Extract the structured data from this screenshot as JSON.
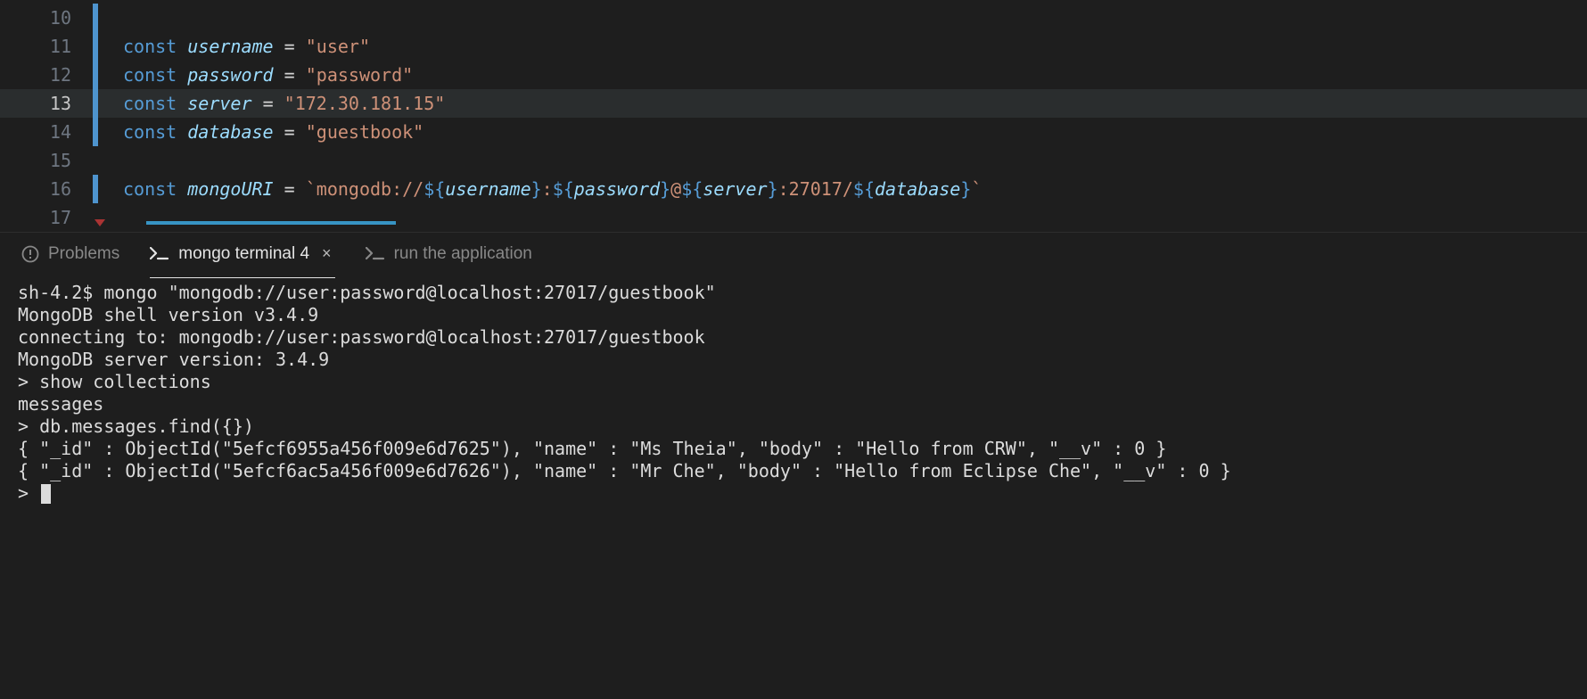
{
  "editor": {
    "lines": [
      {
        "num": "10",
        "git": true,
        "tokens": []
      },
      {
        "num": "11",
        "git": true,
        "tokens": [
          {
            "c": "tok-kw",
            "t": "const"
          },
          {
            "c": "",
            "t": " "
          },
          {
            "c": "tok-var",
            "t": "username"
          },
          {
            "c": "",
            "t": " "
          },
          {
            "c": "tok-op",
            "t": "="
          },
          {
            "c": "",
            "t": " "
          },
          {
            "c": "tok-str",
            "t": "\"user\""
          }
        ]
      },
      {
        "num": "12",
        "git": true,
        "tokens": [
          {
            "c": "tok-kw",
            "t": "const"
          },
          {
            "c": "",
            "t": " "
          },
          {
            "c": "tok-var",
            "t": "password"
          },
          {
            "c": "",
            "t": " "
          },
          {
            "c": "tok-op",
            "t": "="
          },
          {
            "c": "",
            "t": " "
          },
          {
            "c": "tok-str",
            "t": "\"password\""
          }
        ]
      },
      {
        "num": "13",
        "git": true,
        "active": true,
        "tokens": [
          {
            "c": "tok-kw",
            "t": "const"
          },
          {
            "c": "",
            "t": " "
          },
          {
            "c": "tok-var",
            "t": "server"
          },
          {
            "c": "",
            "t": " "
          },
          {
            "c": "tok-op",
            "t": "="
          },
          {
            "c": "",
            "t": " "
          },
          {
            "c": "tok-str",
            "t": "\"172.30.181.15\""
          }
        ]
      },
      {
        "num": "14",
        "git": true,
        "tokens": [
          {
            "c": "tok-kw",
            "t": "const"
          },
          {
            "c": "",
            "t": " "
          },
          {
            "c": "tok-var",
            "t": "database"
          },
          {
            "c": "",
            "t": " "
          },
          {
            "c": "tok-op",
            "t": "="
          },
          {
            "c": "",
            "t": " "
          },
          {
            "c": "tok-str",
            "t": "\"guestbook\""
          }
        ]
      },
      {
        "num": "15",
        "git": false,
        "tokens": []
      },
      {
        "num": "16",
        "git": true,
        "tokens": [
          {
            "c": "tok-kw",
            "t": "const"
          },
          {
            "c": "",
            "t": " "
          },
          {
            "c": "tok-var",
            "t": "mongoURI"
          },
          {
            "c": "",
            "t": " "
          },
          {
            "c": "tok-op",
            "t": "="
          },
          {
            "c": "",
            "t": " "
          },
          {
            "c": "tok-tpl",
            "t": "`mongodb://"
          },
          {
            "c": "tok-interp",
            "t": "${"
          },
          {
            "c": "tok-intvar",
            "t": "username"
          },
          {
            "c": "tok-interp",
            "t": "}"
          },
          {
            "c": "tok-tpl",
            "t": ":"
          },
          {
            "c": "tok-interp",
            "t": "${"
          },
          {
            "c": "tok-intvar",
            "t": "password"
          },
          {
            "c": "tok-interp",
            "t": "}"
          },
          {
            "c": "tok-tpl",
            "t": "@"
          },
          {
            "c": "tok-interp",
            "t": "${"
          },
          {
            "c": "tok-intvar",
            "t": "server"
          },
          {
            "c": "tok-interp",
            "t": "}"
          },
          {
            "c": "tok-tpl",
            "t": ":27017/"
          },
          {
            "c": "tok-interp",
            "t": "${"
          },
          {
            "c": "tok-intvar",
            "t": "database"
          },
          {
            "c": "tok-interp",
            "t": "}"
          },
          {
            "c": "tok-tpl",
            "t": "`"
          }
        ]
      },
      {
        "num": "17",
        "git": false,
        "tokens": []
      }
    ]
  },
  "panel": {
    "tabs": [
      {
        "icon": "alert-icon",
        "label": "Problems",
        "active": false,
        "closable": false
      },
      {
        "icon": "terminal-icon",
        "label": "mongo terminal 4",
        "active": true,
        "closable": true
      },
      {
        "icon": "terminal-icon",
        "label": "run the application",
        "active": false,
        "closable": false
      }
    ]
  },
  "terminal": {
    "lines": [
      "sh-4.2$ mongo \"mongodb://user:password@localhost:27017/guestbook\"",
      "MongoDB shell version v3.4.9",
      "connecting to: mongodb://user:password@localhost:27017/guestbook",
      "MongoDB server version: 3.4.9",
      "> show collections",
      "messages",
      "> db.messages.find({})",
      "{ \"_id\" : ObjectId(\"5efcf6955a456f009e6d7625\"), \"name\" : \"Ms Theia\", \"body\" : \"Hello from CRW\", \"__v\" : 0 }",
      "{ \"_id\" : ObjectId(\"5efcf6ac5a456f009e6d7626\"), \"name\" : \"Mr Che\", \"body\" : \"Hello from Eclipse Che\", \"__v\" : 0 }",
      "> "
    ]
  }
}
